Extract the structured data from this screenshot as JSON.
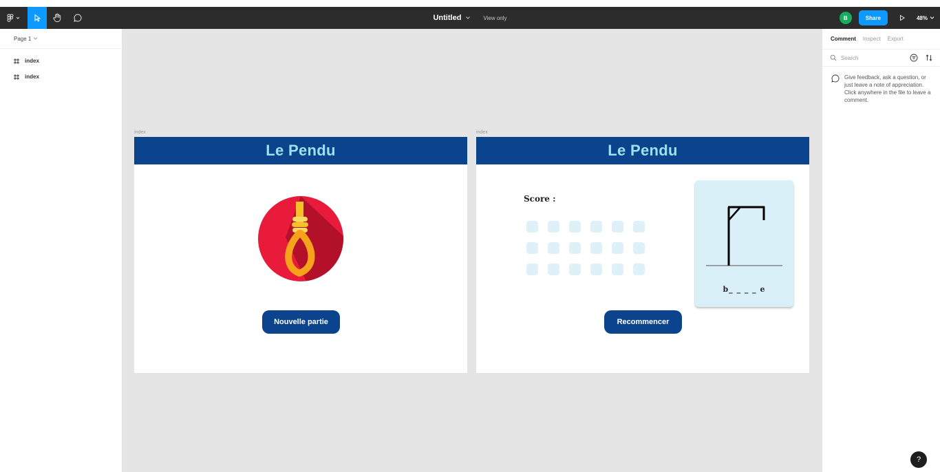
{
  "toolbar": {
    "file_title": "Untitled",
    "view_mode": "View only",
    "avatar_initial": "B",
    "share_label": "Share",
    "zoom_level": "48%"
  },
  "left_panel": {
    "page_label": "Page 1",
    "layers": [
      {
        "name": "index"
      },
      {
        "name": "index"
      }
    ]
  },
  "canvas": {
    "frames": [
      {
        "label": "index",
        "title": "Le Pendu",
        "button_label": "Nouvelle partie"
      },
      {
        "label": "index",
        "title": "Le Pendu",
        "score_label": "Score :",
        "word_hint": "b_ _ _ _ e",
        "button_label": "Recommencer"
      }
    ]
  },
  "right_panel": {
    "tabs": [
      {
        "label": "Comment",
        "active": true
      },
      {
        "label": "Inspect",
        "active": false
      },
      {
        "label": "Export",
        "active": false
      }
    ],
    "search_placeholder": "Search",
    "hint": "Give feedback, ask a question, or just leave a note of appreciation. Click anywhere in the file to leave a comment."
  },
  "help_label": "?",
  "colors": {
    "toolbar_bg": "#2c2c2c",
    "accent": "#0d99ff",
    "header_blue": "#0b448c",
    "title_cyan": "#9fe0ee",
    "key_tile": "#dff1f8",
    "noose_circle": "#e81c3a",
    "rope": "#f5c02b"
  }
}
